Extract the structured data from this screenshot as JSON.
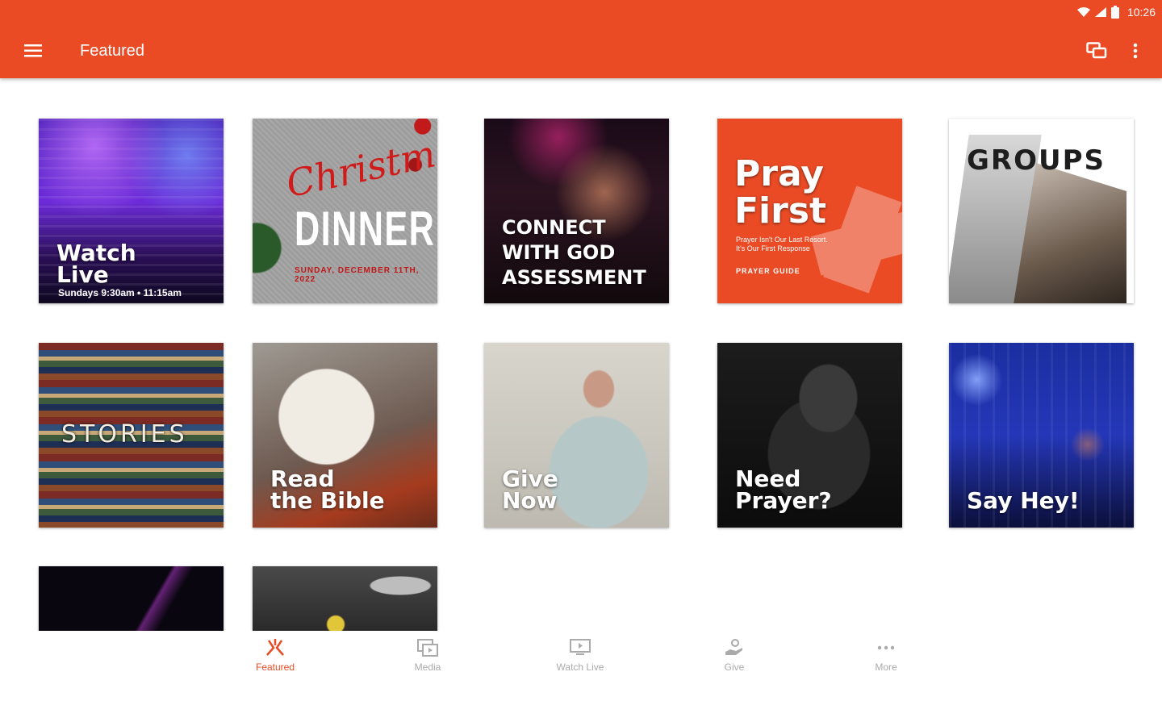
{
  "status_bar": {
    "time": "10:26"
  },
  "app_bar": {
    "title": "Featured"
  },
  "tiles": {
    "watch_live": {
      "title": "Watch\nLive",
      "subtitle": "Sundays 9:30am • 11:15am"
    },
    "christmas_dinner": {
      "script": "Christmas",
      "title": "DINNER",
      "date": "SUNDAY, DECEMBER 11TH, 2022"
    },
    "connect": {
      "title": "CONNECT\nWITH GOD\nASSESSMENT"
    },
    "pray_first": {
      "title": "Pray\nFirst",
      "tagline": "Prayer Isn't Our Last Resort.\nIt's Our First Response",
      "guide": "PRAYER GUIDE"
    },
    "groups": {
      "title": "GROUPS"
    },
    "stories": {
      "title": "STORIES"
    },
    "read_bible": {
      "title": "Read\nthe Bible"
    },
    "give_now": {
      "title": "Give\nNow"
    },
    "need_prayer": {
      "title": "Need\nPrayer?"
    },
    "say_hey": {
      "title": "Say Hey!"
    }
  },
  "bottom_nav": {
    "items": [
      {
        "label": "Featured",
        "icon": "featured-icon",
        "active": true
      },
      {
        "label": "Media",
        "icon": "media-icon",
        "active": false
      },
      {
        "label": "Watch Live",
        "icon": "monitor-icon",
        "active": false
      },
      {
        "label": "Give",
        "icon": "give-icon",
        "active": false
      },
      {
        "label": "More",
        "icon": "more-horizontal-icon",
        "active": false
      }
    ]
  },
  "colors": {
    "primary": "#ea4b25",
    "inactive": "#aaaaaa"
  }
}
